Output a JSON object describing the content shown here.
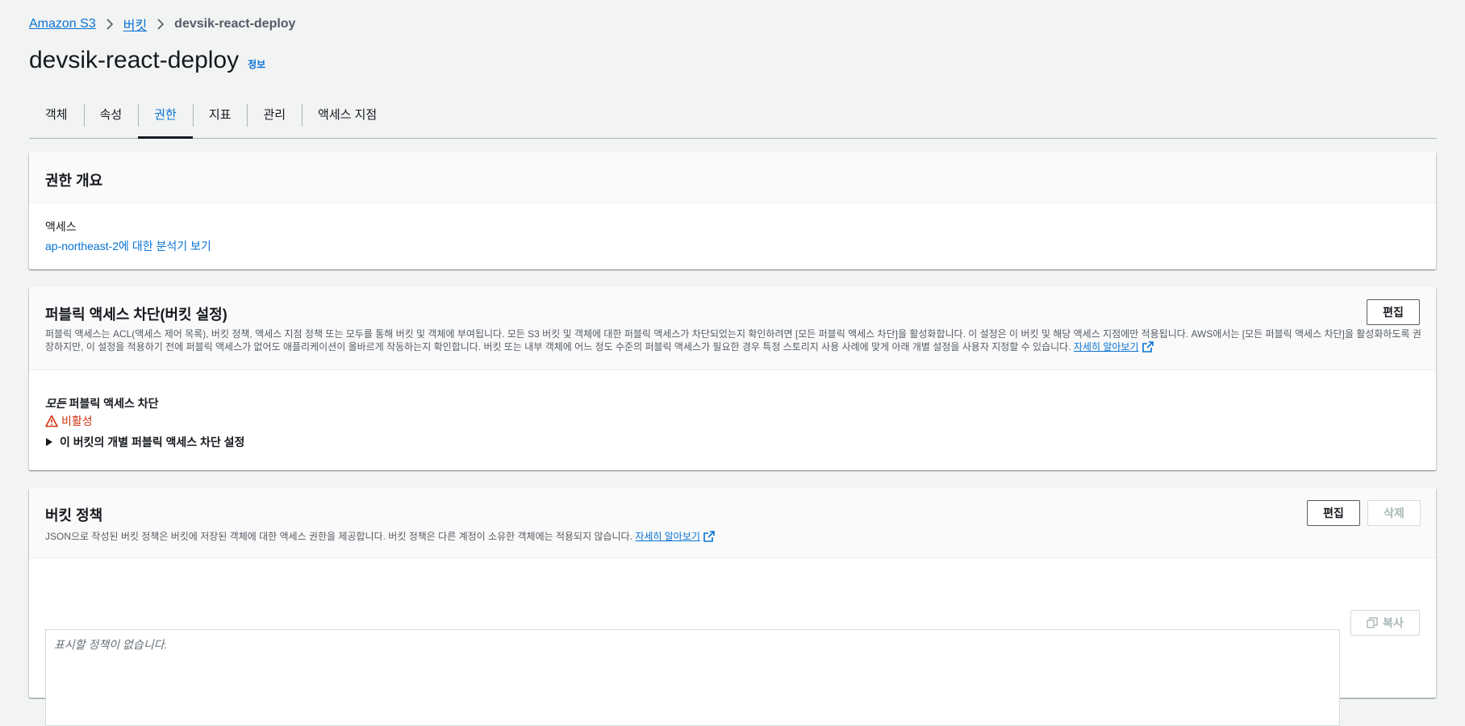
{
  "breadcrumb": {
    "items": [
      "Amazon S3",
      "버킷"
    ],
    "current": "devsik-react-deploy"
  },
  "page": {
    "title": "devsik-react-deploy",
    "info_label": "정보"
  },
  "tabs": [
    {
      "label": "객체",
      "active": false
    },
    {
      "label": "속성",
      "active": false
    },
    {
      "label": "권한",
      "active": true
    },
    {
      "label": "지표",
      "active": false
    },
    {
      "label": "관리",
      "active": false
    },
    {
      "label": "액세스 지점",
      "active": false
    }
  ],
  "overview": {
    "title": "권한 개요",
    "access_label": "액세스",
    "access_link": "ap-northeast-2에 대한 분석기 보기"
  },
  "public_block": {
    "title": "퍼블릭 액세스 차단(버킷 설정)",
    "edit_label": "편집",
    "description": "퍼블릭 액세스는 ACL(액세스 제어 목록), 버킷 정책, 액세스 지점 정책 또는 모두를 통해 버킷 및 객체에 부여됩니다. 모든 S3 버킷 및 객체에 대한 퍼블릭 액세스가 차단되었는지 확인하려면 [모든 퍼블릭 액세스 차단]을 활성화합니다. 이 설정은 이 버킷 및 해당 액세스 지점에만 적용됩니다. AWS에서는 [모든 퍼블릭 액세스 차단]을 활성화하도록 권장하지만, 이 설정을 적용하기 전에 퍼블릭 액세스가 없어도 애플리케이션이 올바르게 작동하는지 확인합니다. 버킷 또는 내부 객체에 어느 정도 수준의 퍼블릭 액세스가 필요한 경우 특정 스토리지 사용 사례에 맞게 아래 개별 설정을 사용자 지정할 수 있습니다.",
    "learn_more": "자세히 알아보기",
    "block_all_italic": "모든",
    "block_all_rest": " 퍼블릭 액세스 차단",
    "status": "비활성",
    "expand_label": "이 버킷의 개별 퍼블릭 액세스 차단 설정"
  },
  "bucket_policy": {
    "title": "버킷 정책",
    "edit_label": "편집",
    "delete_label": "삭제",
    "description": "JSON으로 작성된 버킷 정책은 버킷에 저장된 객체에 대한 액세스 권한을 제공합니다. 버킷 정책은 다른 계정이 소유한 객체에는 적용되지 않습니다.",
    "learn_more": "자세히 알아보기",
    "placeholder": "표시할 정책이 없습니다.",
    "copy_label": "복사"
  },
  "colors": {
    "link": "#0972d3",
    "warning": "#d13212",
    "text": "#16191f",
    "background": "#f2f3f3"
  }
}
